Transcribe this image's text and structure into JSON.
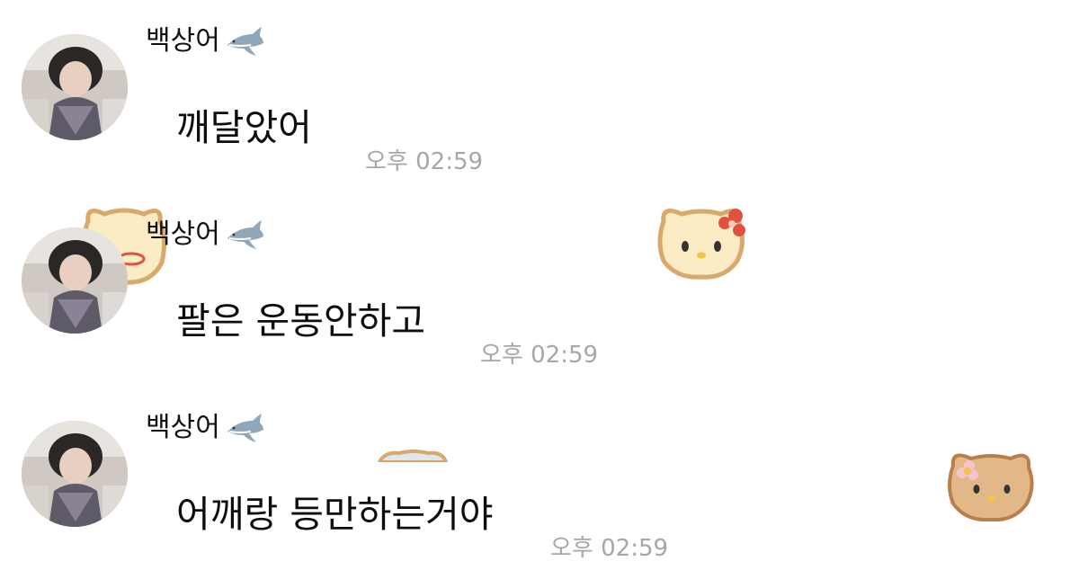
{
  "messages": [
    {
      "sender": "백상어",
      "sender_emoji": "shark-icon",
      "text": "깨달았어",
      "time": "오후 02:59"
    },
    {
      "sender": "백상어",
      "sender_emoji": "shark-icon",
      "text": "팔은 운동안하고",
      "time": "오후 02:59"
    },
    {
      "sender": "백상어",
      "sender_emoji": "shark-icon",
      "text": "어깨랑 등만하는거야",
      "time": "오후 02:59"
    }
  ],
  "stickers": [
    "hello-kitty-cookie-sticker",
    "hello-kitty-cookie-sticker",
    "hello-kitty-cookie-sticker",
    "cookie-sticker",
    "hello-kitty-cookie-sticker"
  ],
  "colors": {
    "background": "#ffffff",
    "text": "#0d0d0d",
    "time": "#a7a7a7",
    "sticker_light": "#fbecc6",
    "sticker_dark": "#d9a96b",
    "bow": "#e0523f"
  }
}
